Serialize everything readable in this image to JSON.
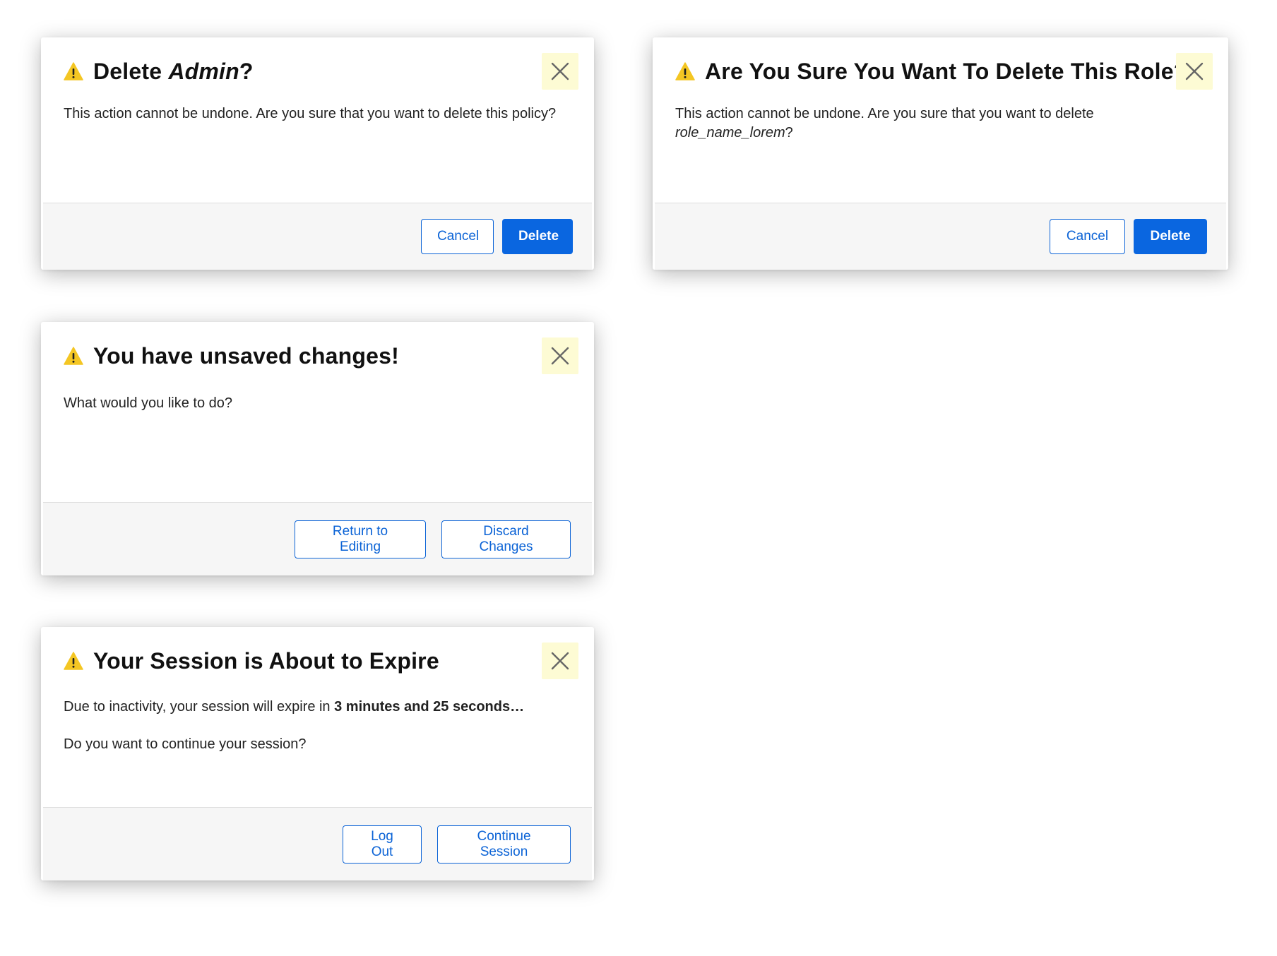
{
  "colors": {
    "warning_icon": "#f4c623",
    "close_button_bg": "#fdfbd4",
    "primary_button": "#0a66e0",
    "secondary_button_text": "#0b63d6",
    "footer_bg": "#f6f6f6"
  },
  "icons": {
    "warning": "warning-triangle-icon",
    "close": "close-x-icon"
  },
  "dialogs": [
    {
      "title_prefix": "Delete ",
      "title_emphasis": "Admin",
      "title_suffix": "?",
      "body": "This action cannot be undone. Are you sure that you want to delete this policy?",
      "cancel_label": "Cancel",
      "delete_label": "Delete"
    },
    {
      "title": "Are You Sure You Want To Delete This Role?",
      "body_prefix": "This action cannot be undone. Are you sure that you want to delete",
      "body_emphasis": "role_name_lorem",
      "body_suffix": "?",
      "cancel_label": "Cancel",
      "delete_label": "Delete"
    },
    {
      "title": "You have unsaved changes!",
      "body": "What would you like to do?",
      "return_label": "Return to Editing",
      "discard_label": "Discard Changes"
    },
    {
      "title": "Your Session is About to Expire",
      "body_prefix": "Due to inactivity, your session will expire in ",
      "body_emphasis": "3 minutes and 25 seconds…",
      "body_question": "Do you want to continue your session?",
      "logout_label": "Log Out",
      "continue_label": "Continue Session"
    }
  ]
}
